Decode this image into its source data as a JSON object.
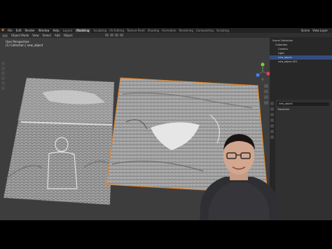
{
  "menubar": {
    "items": [
      "File",
      "Edit",
      "Render",
      "Window",
      "Help"
    ],
    "workspace_tabs": [
      "Layout",
      "Modeling",
      "Sculpting",
      "UV Editing",
      "Texture Paint",
      "Shading",
      "Animation",
      "Rendering",
      "Compositing",
      "Scripting"
    ],
    "active_workspace": "Modeling",
    "scene": "Scene",
    "view_layer": "View Layer"
  },
  "header": {
    "mode": "Object Mode",
    "items": [
      "View",
      "Select",
      "Add",
      "Object"
    ],
    "orientation": "Global"
  },
  "viewport": {
    "view_name": "User Perspective",
    "collection_label": "(1) Collection | new_object"
  },
  "outliner": {
    "rows": [
      "Scene Collection",
      "Collection",
      "Camera",
      "Light",
      "new_object",
      "new_object.001"
    ]
  },
  "properties": {
    "object_name": "new_object",
    "section": "Transform"
  },
  "colors": {
    "selection_outline": "#e8801c",
    "outliner_highlight": "#334d80",
    "viewport_bg": "#3d3d3d"
  }
}
